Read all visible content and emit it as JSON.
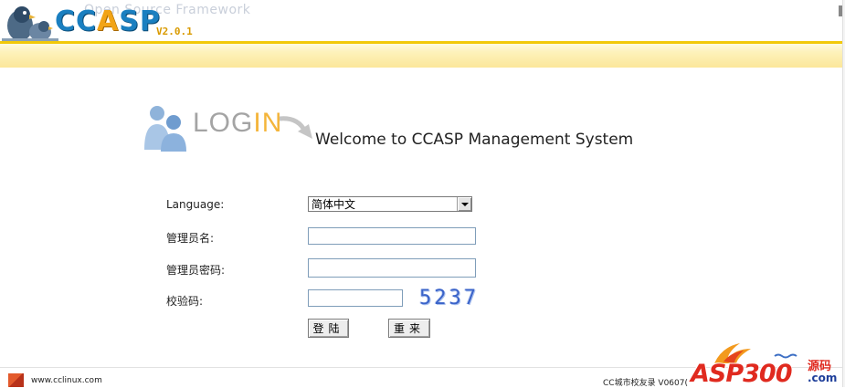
{
  "header": {
    "subtitle": "Open Source Framework",
    "brand_prefix": "CC",
    "brand_a": "A",
    "brand_suffix": "SP",
    "version": "V2.0.1"
  },
  "login_banner": {
    "login_part1": "LOG",
    "login_part2": "IN",
    "welcome": "Welcome to CCASP Management System"
  },
  "form": {
    "language_label": "Language:",
    "language_value": "简体中文",
    "username_label": "管理员名:",
    "username_value": "",
    "password_label": "管理员密码:",
    "password_value": "",
    "captcha_label": "校验码:",
    "captcha_value": "",
    "captcha_code": "5237",
    "submit_label": "登陆",
    "reset_label": "重来"
  },
  "footer": {
    "url": "www.cclinux.com",
    "copyright": "CC城市校友录 V0607(",
    "watermark_text": "ASP300",
    "watermark_cn": "源码",
    "watermark_com": ".com"
  },
  "colors": {
    "accent_yellow": "#f2c90a",
    "brand_blue": "#1a7fc0",
    "brand_orange": "#f2a417",
    "captcha_blue": "#3a63c9",
    "watermark_red": "#e02a1f"
  },
  "icons": {
    "header_logo": "parrot-bird-icon",
    "login_banner": "people-icon",
    "login_arrow": "curved-arrow-icon",
    "footer": "cclinux-icon",
    "dropdown": "chevron-down-icon"
  }
}
